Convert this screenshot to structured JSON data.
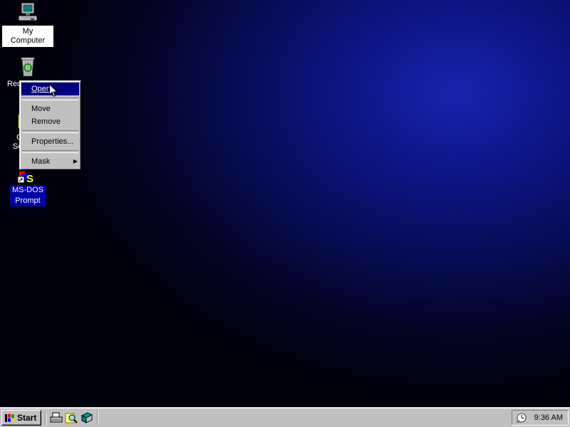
{
  "desktop": {
    "icons": [
      {
        "name": "my-computer",
        "label": "My Computer",
        "icon": "computer-icon"
      },
      {
        "name": "recycle-bin",
        "label": "Recycle Bin",
        "icon": "recycle-bin-icon"
      },
      {
        "name": "online-services",
        "label": "Online Services",
        "icon": "folder-icon"
      },
      {
        "name": "ms-dos-prompt",
        "label_line1": "MS-DOS",
        "label_line2": "Prompt",
        "icon": "ms-dos-icon"
      }
    ],
    "colors": {
      "background_accent": "#1a28c8",
      "selection": "#0000a8"
    }
  },
  "context_menu": {
    "items": [
      {
        "label": "Open",
        "highlighted": true
      },
      {
        "label": "Move"
      },
      {
        "label": "Remove"
      },
      {
        "label": "Properties..."
      },
      {
        "label": "Mask",
        "submenu": true
      }
    ]
  },
  "taskbar": {
    "start_label": "Start",
    "quick_launch": [
      "printer-icon",
      "find-icon",
      "desktop-icon"
    ],
    "clock": "9:36 AM",
    "tray_icon": "scheduler-icon"
  }
}
